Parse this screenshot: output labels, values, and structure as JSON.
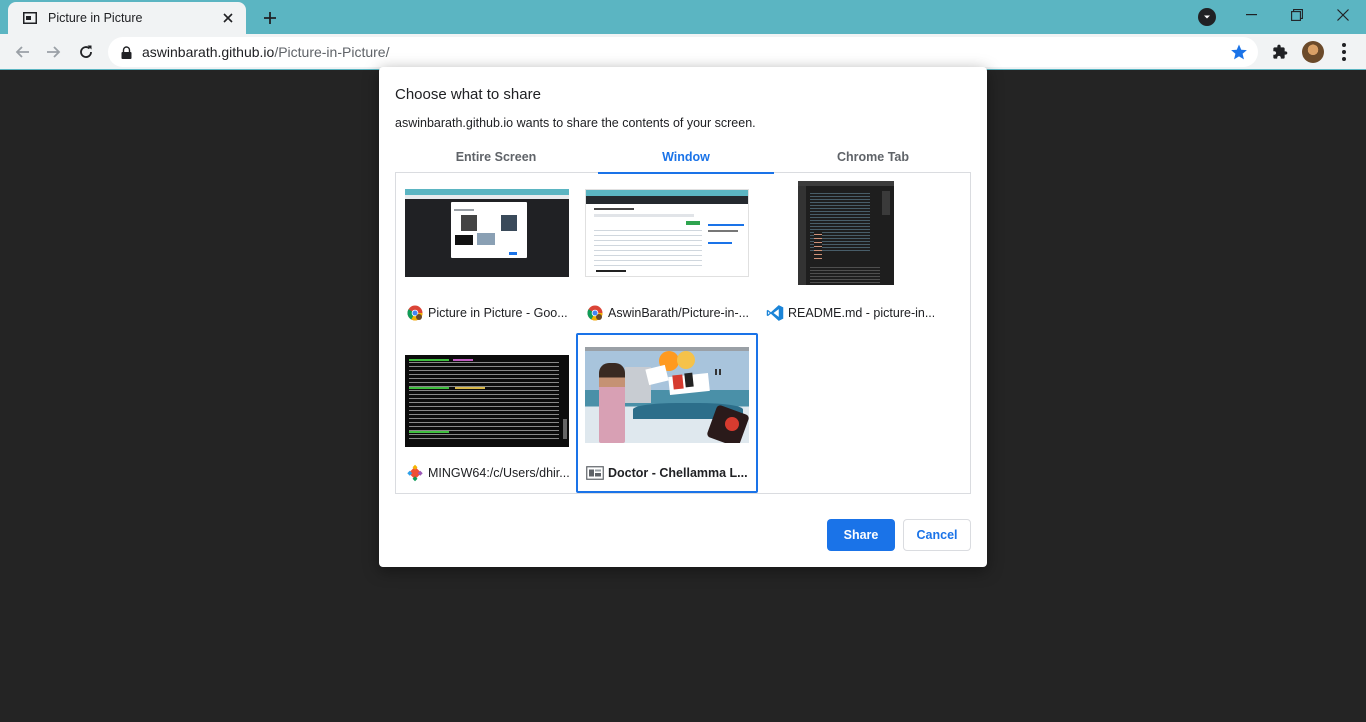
{
  "browser": {
    "tab_title": "Picture in Picture",
    "url_host": "aswinbarath.github.io",
    "url_path": "/Picture-in-Picture/",
    "icons": {
      "favicon": "picture-in-picture-icon",
      "close": "close-icon",
      "new_tab": "plus-icon",
      "tab_search": "chevron-down-icon",
      "back": "back-arrow-icon",
      "forward": "forward-arrow-icon",
      "reload": "reload-icon",
      "lock": "lock-icon",
      "bookmark": "star-icon",
      "extensions": "puzzle-icon",
      "menu": "more-vertical-icon"
    },
    "colors": {
      "frame": "#5bb5c2",
      "accent": "#1a73e8"
    }
  },
  "dialog": {
    "title": "Choose what to share",
    "subtitle": "aswinbarath.github.io wants to share the contents of your screen.",
    "tabs": [
      {
        "label": "Entire Screen",
        "active": false
      },
      {
        "label": "Window",
        "active": true
      },
      {
        "label": "Chrome Tab",
        "active": false
      }
    ],
    "windows": [
      {
        "label": "Picture in Picture - Goo...",
        "app_icon": "chrome-icon",
        "selected": false
      },
      {
        "label": "AswinBarath/Picture-in-...",
        "app_icon": "chrome-icon",
        "selected": false
      },
      {
        "label": "README.md - picture-in...",
        "app_icon": "vscode-icon",
        "selected": false
      },
      {
        "label": "MINGW64:/c/Users/dhir...",
        "app_icon": "git-icon",
        "selected": false
      },
      {
        "label": "Doctor - Chellamma L...",
        "app_icon": "pip-window-icon",
        "selected": true
      }
    ],
    "share_label": "Share",
    "cancel_label": "Cancel"
  }
}
